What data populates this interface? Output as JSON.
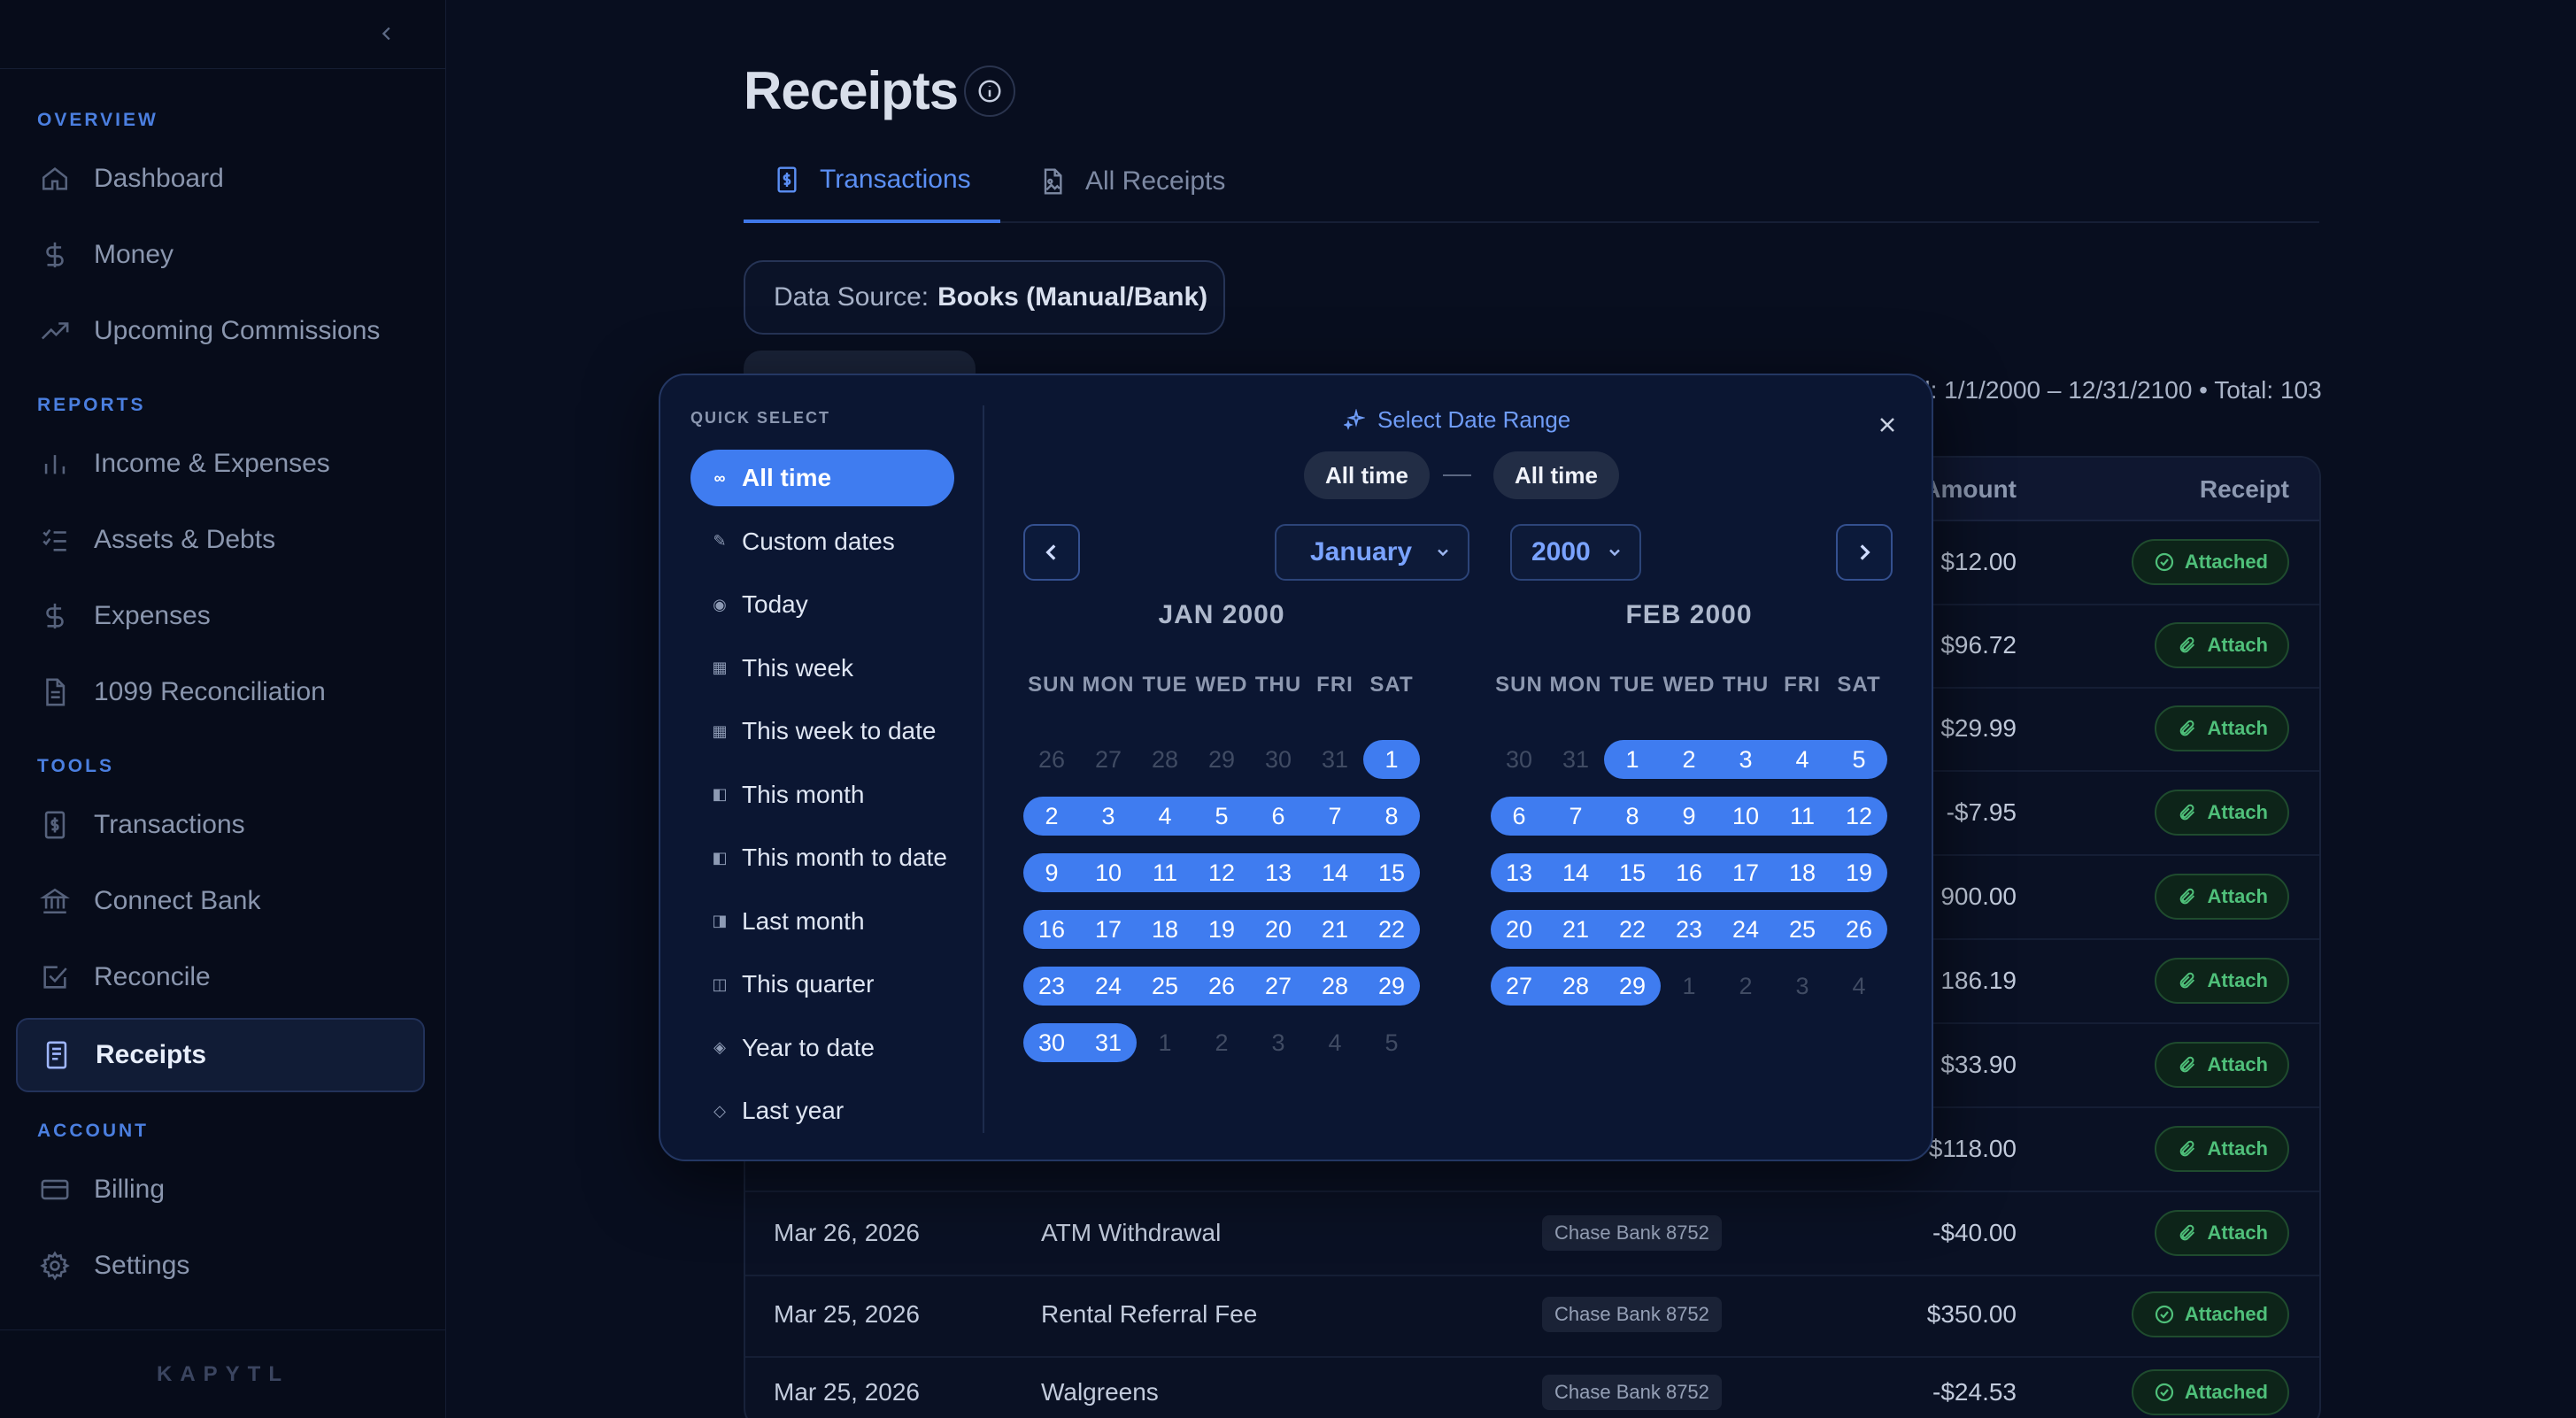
{
  "sidebar": {
    "sections": {
      "overview": "OVERVIEW",
      "reports": "REPORTS",
      "tools": "TOOLS",
      "account": "ACCOUNT"
    },
    "items": {
      "dashboard": "Dashboard",
      "money": "Money",
      "upcoming": "Upcoming Commissions",
      "income": "Income & Expenses",
      "assets": "Assets & Debts",
      "expenses": "Expenses",
      "reconciliation1099": "1099 Reconciliation",
      "transactions": "Transactions",
      "connect_bank": "Connect Bank",
      "reconcile": "Reconcile",
      "receipts": "Receipts",
      "billing": "Billing",
      "settings": "Settings"
    },
    "brand": "KAPYTL"
  },
  "page": {
    "title": "Receipts",
    "tabs": {
      "transactions": "Transactions",
      "all_receipts": "All Receipts"
    },
    "data_source_label": "Data Source:",
    "data_source_value": "Books (Manual/Bank)",
    "period_info": "d: 1/1/2000 – 12/31/2100 • Total: 103"
  },
  "table": {
    "headers": {
      "amount": "Amount",
      "receipt": "Receipt"
    },
    "rows": [
      {
        "date": "",
        "desc": "",
        "bank": "",
        "amount": "$12.00",
        "receipt": "Attached"
      },
      {
        "date": "",
        "desc": "",
        "bank": "",
        "amount": "$96.72",
        "receipt": "Attach"
      },
      {
        "date": "",
        "desc": "",
        "bank": "",
        "amount": "$29.99",
        "receipt": "Attach"
      },
      {
        "date": "",
        "desc": "",
        "bank": "",
        "amount": "-$7.95",
        "receipt": "Attach"
      },
      {
        "date": "",
        "desc": "",
        "bank": "",
        "amount": "900.00",
        "receipt": "Attach"
      },
      {
        "date": "",
        "desc": "",
        "bank": "",
        "amount": "186.19",
        "receipt": "Attach"
      },
      {
        "date": "",
        "desc": "",
        "bank": "",
        "amount": "$33.90",
        "receipt": "Attach"
      },
      {
        "date": "",
        "desc": "",
        "bank": "",
        "amount": "$118.00",
        "receipt": "Attach"
      },
      {
        "date": "Mar 26, 2026",
        "desc": "ATM Withdrawal",
        "bank": "Chase Bank 8752",
        "amount": "-$40.00",
        "receipt": "Attach"
      },
      {
        "date": "Mar 25, 2026",
        "desc": "Rental Referral Fee",
        "bank": "Chase Bank 8752",
        "amount": "$350.00",
        "receipt": "Attached"
      },
      {
        "date": "Mar 25, 2026",
        "desc": "Walgreens",
        "bank": "Chase Bank 8752",
        "amount": "-$24.53",
        "receipt": "Attached"
      }
    ]
  },
  "picker": {
    "quick_select_label": "QUICK SELECT",
    "quick": [
      {
        "glyph": "∞",
        "label": "All time",
        "active": true
      },
      {
        "glyph": "✎",
        "label": "Custom dates"
      },
      {
        "glyph": "◉",
        "label": "Today"
      },
      {
        "glyph": "▦",
        "label": "This week"
      },
      {
        "glyph": "▦",
        "label": "This week to date"
      },
      {
        "glyph": "◧",
        "label": "This month"
      },
      {
        "glyph": "◧",
        "label": "This month to date"
      },
      {
        "glyph": "◨",
        "label": "Last month"
      },
      {
        "glyph": "◫",
        "label": "This quarter"
      },
      {
        "glyph": "◈",
        "label": "Year to date"
      },
      {
        "glyph": "◇",
        "label": "Last year"
      }
    ],
    "title": "Select Date Range",
    "range_start": "All time",
    "range_end": "All time",
    "month_select": "January",
    "year_select": "2000",
    "weekdays": [
      "SUN",
      "MON",
      "TUE",
      "WED",
      "THU",
      "FRI",
      "SAT"
    ],
    "months": [
      {
        "title": "JAN 2000",
        "weeks": [
          [
            [
              "26",
              0
            ],
            [
              "27",
              0
            ],
            [
              "28",
              0
            ],
            [
              "29",
              0
            ],
            [
              "30",
              0
            ],
            [
              "31",
              0
            ],
            [
              "1",
              1
            ]
          ],
          [
            [
              "2",
              1
            ],
            [
              "3",
              1
            ],
            [
              "4",
              1
            ],
            [
              "5",
              1
            ],
            [
              "6",
              1
            ],
            [
              "7",
              1
            ],
            [
              "8",
              1
            ]
          ],
          [
            [
              "9",
              1
            ],
            [
              "10",
              1
            ],
            [
              "11",
              1
            ],
            [
              "12",
              1
            ],
            [
              "13",
              1
            ],
            [
              "14",
              1
            ],
            [
              "15",
              1
            ]
          ],
          [
            [
              "16",
              1
            ],
            [
              "17",
              1
            ],
            [
              "18",
              1
            ],
            [
              "19",
              1
            ],
            [
              "20",
              1
            ],
            [
              "21",
              1
            ],
            [
              "22",
              1
            ]
          ],
          [
            [
              "23",
              1
            ],
            [
              "24",
              1
            ],
            [
              "25",
              1
            ],
            [
              "26",
              1
            ],
            [
              "27",
              1
            ],
            [
              "28",
              1
            ],
            [
              "29",
              1
            ]
          ],
          [
            [
              "30",
              1
            ],
            [
              "31",
              1
            ],
            [
              "1",
              0
            ],
            [
              "2",
              0
            ],
            [
              "3",
              0
            ],
            [
              "4",
              0
            ],
            [
              "5",
              0
            ]
          ]
        ]
      },
      {
        "title": "FEB 2000",
        "weeks": [
          [
            [
              "30",
              0
            ],
            [
              "31",
              0
            ],
            [
              "1",
              1
            ],
            [
              "2",
              1
            ],
            [
              "3",
              1
            ],
            [
              "4",
              1
            ],
            [
              "5",
              1
            ]
          ],
          [
            [
              "6",
              1
            ],
            [
              "7",
              1
            ],
            [
              "8",
              1
            ],
            [
              "9",
              1
            ],
            [
              "10",
              1
            ],
            [
              "11",
              1
            ],
            [
              "12",
              1
            ]
          ],
          [
            [
              "13",
              1
            ],
            [
              "14",
              1
            ],
            [
              "15",
              1
            ],
            [
              "16",
              1
            ],
            [
              "17",
              1
            ],
            [
              "18",
              1
            ],
            [
              "19",
              1
            ]
          ],
          [
            [
              "20",
              1
            ],
            [
              "21",
              1
            ],
            [
              "22",
              1
            ],
            [
              "23",
              1
            ],
            [
              "24",
              1
            ],
            [
              "25",
              1
            ],
            [
              "26",
              1
            ]
          ],
          [
            [
              "27",
              1
            ],
            [
              "28",
              1
            ],
            [
              "29",
              1
            ],
            [
              "1",
              0
            ],
            [
              "2",
              0
            ],
            [
              "3",
              0
            ],
            [
              "4",
              0
            ]
          ]
        ]
      }
    ]
  },
  "colors": {
    "accent": "#3f7cf0",
    "success": "#4fc07a",
    "background": "#080e1f"
  }
}
